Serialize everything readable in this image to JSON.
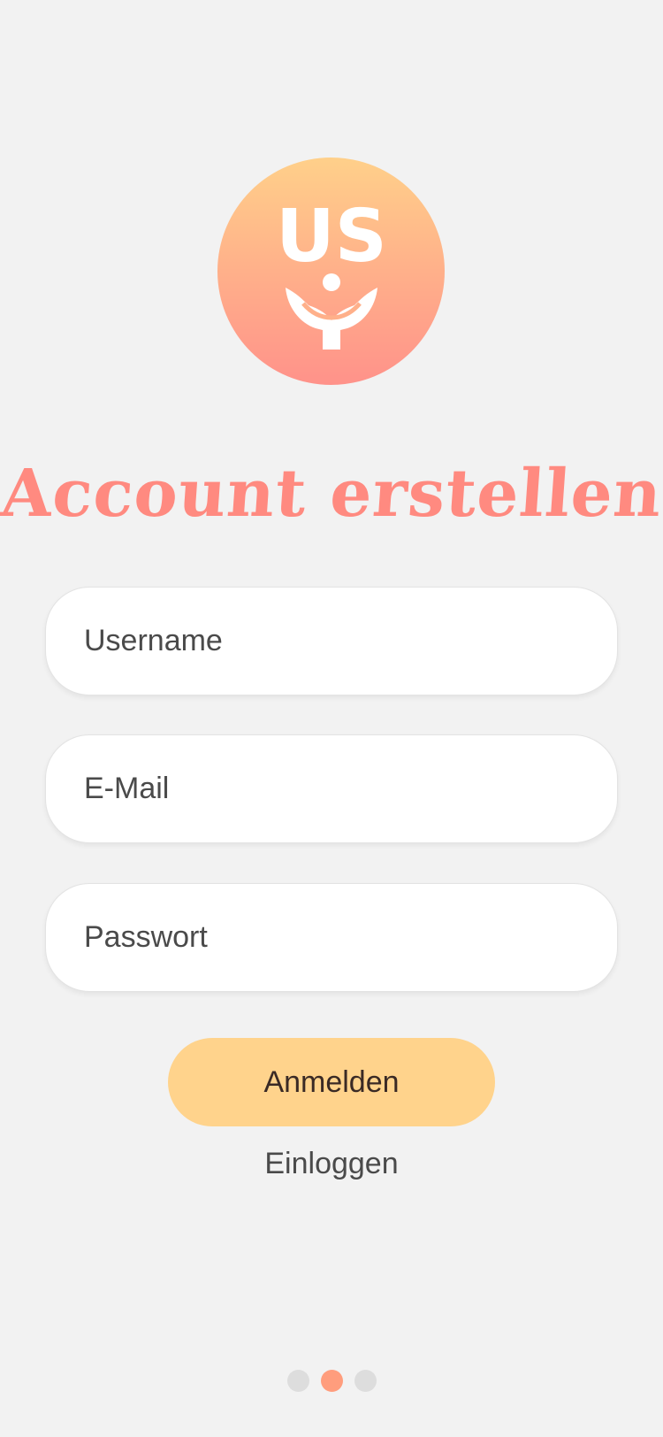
{
  "logo": {
    "text": "US",
    "icon": "hands-holding-icon"
  },
  "title": "Account erstellen",
  "form": {
    "username_placeholder": "Username",
    "email_placeholder": "E-Mail",
    "password_placeholder": "Passwort"
  },
  "primary_button": "Anmelden",
  "secondary_link": "Einloggen",
  "pager": {
    "count": 3,
    "active_index": 1
  },
  "colors": {
    "background": "#f2f2f2",
    "title": "#ff8a80",
    "button": "#ffd38c",
    "active_dot": "#ff9d7d",
    "inactive_dot": "#dddddd"
  }
}
